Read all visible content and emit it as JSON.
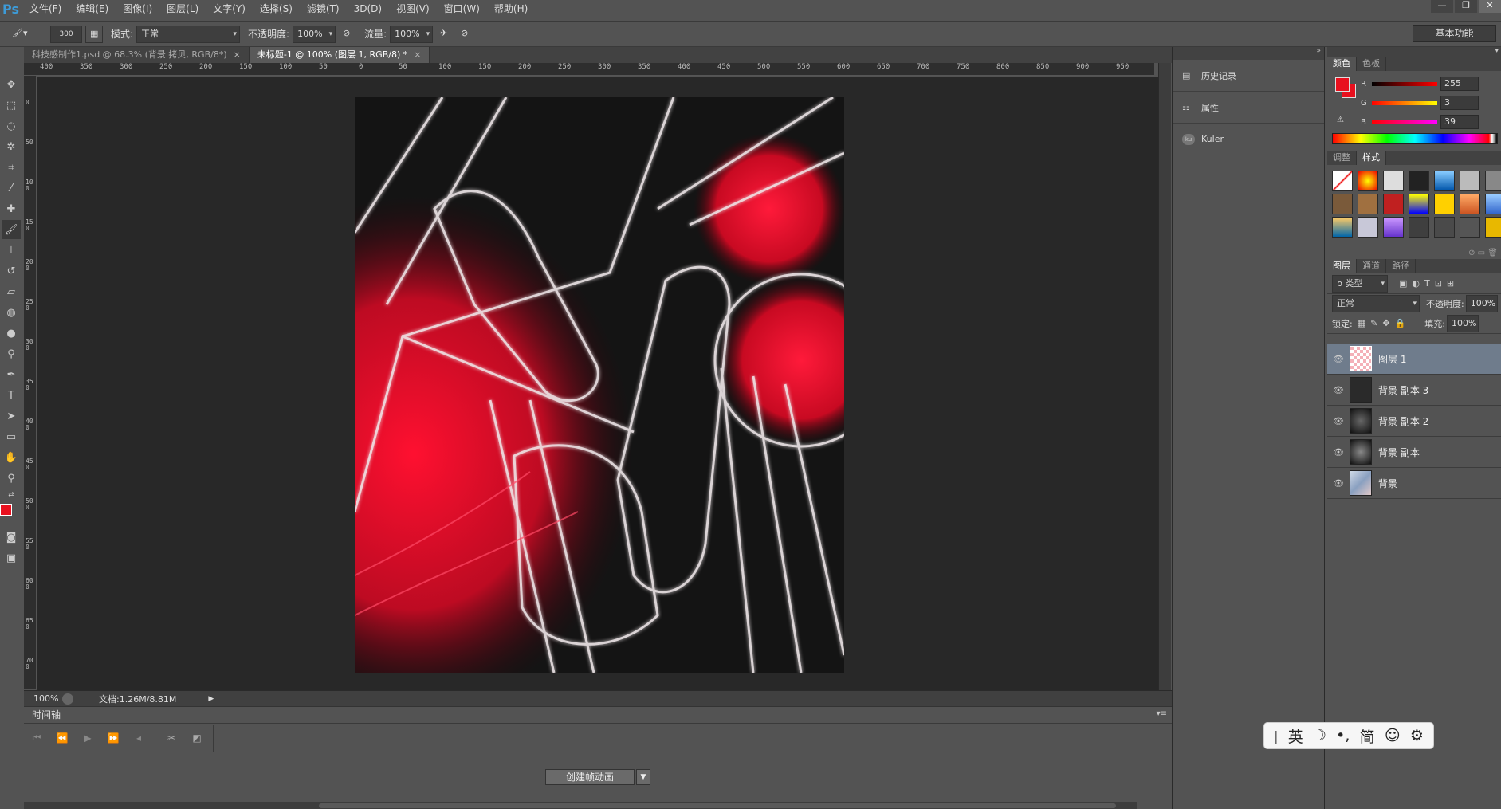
{
  "app": {
    "logo": "Ps"
  },
  "menu": [
    "文件(F)",
    "编辑(E)",
    "图像(I)",
    "图层(L)",
    "文字(Y)",
    "选择(S)",
    "滤镜(T)",
    "3D(D)",
    "视图(V)",
    "窗口(W)",
    "帮助(H)"
  ],
  "window_buttons": {
    "minimize": "—",
    "restore": "❐",
    "close": "✕"
  },
  "options": {
    "brush_size": "300",
    "mode_label": "模式:",
    "mode_value": "正常",
    "opacity_label": "不透明度:",
    "opacity_value": "100%",
    "flow_label": "流量:",
    "flow_value": "100%"
  },
  "workspace": "基本功能",
  "tabs": [
    {
      "label": "科技感制作1.psd @ 68.3% (背景 拷贝, RGB/8*)",
      "close": "×"
    },
    {
      "label": "未标题-1 @ 100% (图层 1, RGB/8) *",
      "close": "×"
    }
  ],
  "ruler_h": [
    "400",
    "350",
    "300",
    "250",
    "200",
    "150",
    "100",
    "50",
    "0",
    "50",
    "100",
    "150",
    "200",
    "250",
    "300",
    "350",
    "400",
    "450",
    "500",
    "550",
    "600",
    "650",
    "700",
    "750",
    "800",
    "850",
    "900",
    "950"
  ],
  "ruler_v": [
    "0",
    "50",
    "100",
    "150",
    "200",
    "250",
    "300",
    "350",
    "400",
    "450",
    "500",
    "550",
    "600",
    "650",
    "700"
  ],
  "status": {
    "zoom": "100%",
    "doc": "文档:1.26M/8.81M"
  },
  "timeline": {
    "title": "时间轴",
    "create_button": "创建帧动画"
  },
  "mid_panel": [
    {
      "icon": "history-icon",
      "label": "历史记录"
    },
    {
      "icon": "properties-icon",
      "label": "属性"
    },
    {
      "icon": "kuler-icon",
      "label": "Kuler"
    }
  ],
  "color_panel": {
    "tabs": [
      "颜色",
      "色板"
    ],
    "fg_color": "#e8101e",
    "channels": [
      {
        "name": "R",
        "value": "255"
      },
      {
        "name": "G",
        "value": "3"
      },
      {
        "name": "B",
        "value": "39"
      }
    ]
  },
  "styles_panel": {
    "tabs": [
      "调整",
      "样式"
    ]
  },
  "layers_panel": {
    "tabs": [
      "图层",
      "通道",
      "路径"
    ],
    "filter_label": "ρ 类型",
    "blend_mode": "正常",
    "opacity_label": "不透明度:",
    "opacity_value": "100%",
    "lock_label": "锁定:",
    "fill_label": "填充:",
    "fill_value": "100%",
    "layers": [
      {
        "name": "图层 1",
        "selected": true
      },
      {
        "name": "背景 副本 3",
        "selected": false
      },
      {
        "name": "背景 副本 2",
        "selected": false
      },
      {
        "name": "背景 副本",
        "selected": false
      },
      {
        "name": "背景",
        "selected": false
      }
    ]
  },
  "ime": {
    "lang": "英",
    "mode": "简"
  }
}
